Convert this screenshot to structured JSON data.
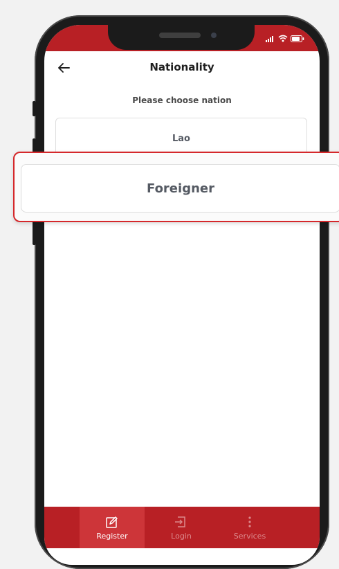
{
  "header": {
    "title": "Nationality",
    "back_icon": "arrow-left-icon"
  },
  "prompt": "Please choose nation",
  "options": [
    {
      "label": "Lao"
    },
    {
      "label": "Foreigner",
      "highlighted": true
    }
  ],
  "bottom_nav": [
    {
      "label": "Register",
      "icon": "edit-icon",
      "active": true
    },
    {
      "label": "Login",
      "icon": "login-icon",
      "active": false
    },
    {
      "label": "Services",
      "icon": "more-vertical-icon",
      "active": false
    }
  ],
  "status_bar": {
    "icons": [
      "signal-icon",
      "wifi-icon",
      "battery-icon"
    ]
  },
  "colors": {
    "primary": "#b82025",
    "active_tab": "#cd3539",
    "inactive_tab_text": "#dc8a8d",
    "highlight_border": "#d5282b",
    "option_text": "#555a63"
  }
}
